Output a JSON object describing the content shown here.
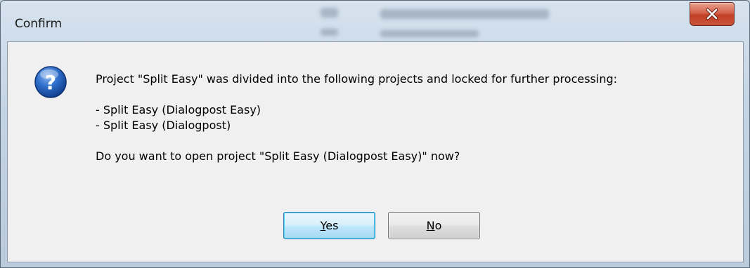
{
  "window": {
    "title": "Confirm",
    "close_glyph": "X"
  },
  "icon": {
    "name": "question-icon",
    "glyph": "?",
    "color": "#1f5fb8"
  },
  "message": {
    "line1": "Project \"Split Easy\" was divided into the following projects and locked for further processing:",
    "projects": [
      "- Split Easy (Dialogpost Easy)",
      "- Split Easy (Dialogpost)"
    ],
    "question": "Do you want to open project \"Split Easy (Dialogpost Easy)\" now?"
  },
  "buttons": {
    "yes": {
      "mnemonic": "Y",
      "rest": "es"
    },
    "no": {
      "mnemonic": "N",
      "rest": "o"
    }
  }
}
